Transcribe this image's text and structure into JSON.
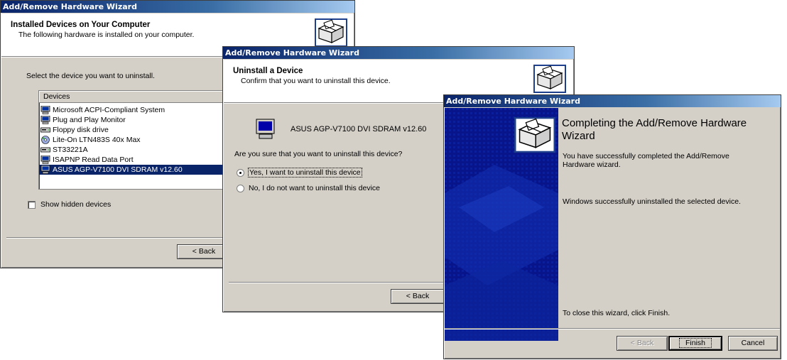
{
  "window1": {
    "title": "Add/Remove Hardware Wizard",
    "header_title": "Installed Devices on Your Computer",
    "header_subtitle": "The following hardware is installed on your computer.",
    "prompt": "Select the device you want to uninstall.",
    "list_header": "Devices",
    "devices": [
      {
        "label": "Microsoft ACPI-Compliant System",
        "icon": "computer-icon"
      },
      {
        "label": "Plug and Play Monitor",
        "icon": "monitor-icon"
      },
      {
        "label": "Floppy disk drive",
        "icon": "floppy-drive-icon"
      },
      {
        "label": "Lite-On LTN483S 40x Max",
        "icon": "cd-drive-icon"
      },
      {
        "label": "ST33221A",
        "icon": "hard-drive-icon"
      },
      {
        "label": "ISAPNP Read Data Port",
        "icon": "computer-icon"
      },
      {
        "label": "ASUS AGP-V7100 DVI SDRAM v12.60",
        "icon": "display-adapter-icon",
        "selected": true
      }
    ],
    "show_hidden_label": "Show hidden devices",
    "back_button": "< Back"
  },
  "window2": {
    "title": "Add/Remove Hardware Wizard",
    "header_title": "Uninstall a Device",
    "header_subtitle": "Confirm that you want to uninstall this device.",
    "device_name": "ASUS AGP-V7100 DVI SDRAM v12.60",
    "question": "Are you sure that you want to uninstall this device?",
    "option_yes": "Yes, I want to uninstall this device",
    "option_no": "No, I do not want to uninstall this device",
    "selected_option": "yes",
    "back_button": "< Back"
  },
  "window3": {
    "title": "Add/Remove Hardware Wizard",
    "heading": "Completing the Add/Remove Hardware Wizard",
    "text1": "You have successfully completed the Add/Remove Hardware wizard.",
    "text2": "Windows successfully uninstalled the selected device.",
    "close_text": "To close this wizard, click Finish.",
    "back_button": "< Back",
    "finish_button": "Finish",
    "cancel_button": "Cancel"
  },
  "colors": {
    "title_gradient_start": "#0a246a",
    "dialog_face": "#d4d0c8",
    "selection": "#0a246a",
    "side_panel": "#08148a"
  }
}
